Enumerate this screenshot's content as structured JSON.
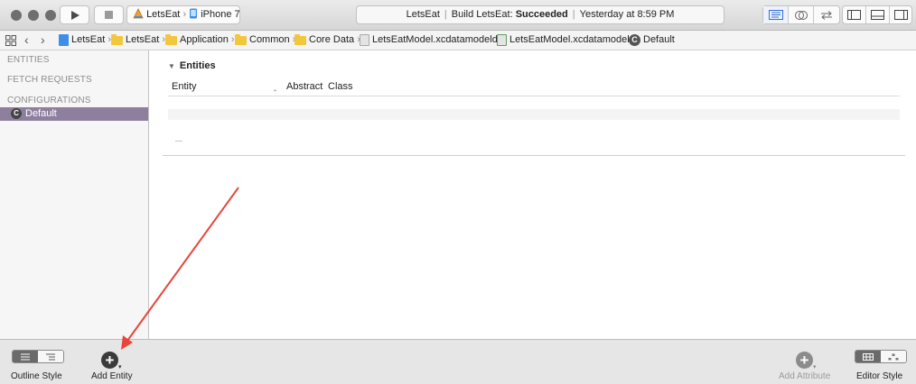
{
  "toolbar": {
    "scheme": {
      "project": "LetsEat",
      "device": "iPhone 7"
    },
    "status": {
      "project": "LetsEat",
      "build_prefix": "Build LetsEat:",
      "build_result": "Succeeded",
      "timestamp": "Yesterday at 8:59 PM"
    }
  },
  "jumpbar": {
    "items": [
      "LetsEat",
      "LetsEat",
      "Application",
      "Common",
      "Core Data",
      "LetsEatModel.xcdatamodeld",
      "LetsEatModel.xcdatamodel",
      "Default"
    ]
  },
  "sidebar": {
    "sections": [
      "ENTITIES",
      "FETCH REQUESTS",
      "CONFIGURATIONS"
    ],
    "selected_item": "Default",
    "badge_letter": "C"
  },
  "main": {
    "section_title": "Entities",
    "columns": [
      "Entity",
      "Abstract",
      "Class"
    ],
    "placeholder_row": "—"
  },
  "bottombar": {
    "outline_style": "Outline Style",
    "add_entity": "Add Entity",
    "add_attribute": "Add Attribute",
    "editor_style": "Editor Style"
  },
  "colors": {
    "selection": "#8f7f9f",
    "annotation_arrow": "#e8453c",
    "folder": "#f3c73b"
  }
}
